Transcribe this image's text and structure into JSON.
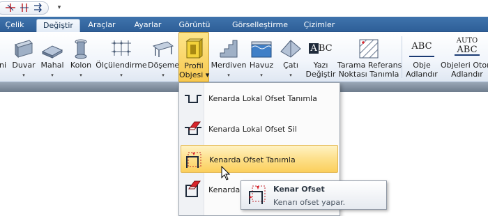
{
  "quick_access": {
    "icons": [
      "axis-icon",
      "offset-axis-icon",
      "redo-icon"
    ],
    "customize": "▾"
  },
  "tabs": [
    {
      "label": "Çelik",
      "active": false
    },
    {
      "label": "Değiştir",
      "active": true
    },
    {
      "label": "Araçlar",
      "active": false
    },
    {
      "label": "Ayarlar",
      "active": false
    },
    {
      "label": "Görüntü",
      "active": false
    },
    {
      "label": "Görselleştirme",
      "active": false
    },
    {
      "label": "Çizimler",
      "active": false
    }
  ],
  "ribbon": {
    "buttons": [
      {
        "label1": "ni",
        "label2": "",
        "icon": "wall-icon",
        "arrow": ""
      },
      {
        "label1": "Duvar",
        "label2": "",
        "icon": "wall-icon",
        "arrow": "▾"
      },
      {
        "label1": "Mahal",
        "label2": "",
        "icon": "room-slab-icon",
        "arrow": "▾"
      },
      {
        "label1": "Kolon",
        "label2": "",
        "icon": "column-icon",
        "arrow": "▾"
      },
      {
        "label1": "Ölçülendirme",
        "label2": "",
        "icon": "dimension-icon",
        "arrow": "▾"
      },
      {
        "label1": "Döşeme",
        "label2": "",
        "icon": "floor-slab-icon",
        "arrow": "▾"
      },
      {
        "label1": "Profil",
        "label2": "Objesi ▾",
        "icon": "profile-object-icon",
        "arrow": ""
      },
      {
        "label1": "Merdiven",
        "label2": "",
        "icon": "stairs-icon",
        "arrow": "▾"
      },
      {
        "label1": "Havuz",
        "label2": "",
        "icon": "pool-icon",
        "arrow": "▾"
      },
      {
        "label1": "Çatı",
        "label2": "",
        "icon": "roof-icon",
        "arrow": "▾"
      },
      {
        "label1": "Yazı",
        "label2": "Değiştir",
        "icon": "text-edit-icon",
        "arrow": ""
      },
      {
        "label1": "Tarama Referans",
        "label2": "Noktası Tanımla",
        "icon": "hatch-reference-icon",
        "arrow": ""
      },
      {
        "label1": "Obje",
        "label2": "Adlandır",
        "icon": "object-name-icon",
        "arrow": ""
      },
      {
        "label1": "Objeleri Otom",
        "label2": "Adlandır",
        "icon": "auto-name-icon",
        "arrow": ""
      }
    ],
    "text_icons": {
      "abc": "ABC",
      "auto": "AUTO",
      "abc_b": "ABC",
      "text_aa": "A",
      "text_bc": "BC"
    }
  },
  "dropdown": {
    "items": [
      {
        "label": "Kenarda Lokal Ofset Tanımla",
        "icon": "local-offset-icon",
        "hover": false
      },
      {
        "label": "Kenarda Lokal Ofset Sil",
        "icon": "local-offset-delete-icon",
        "hover": false
      },
      {
        "label": "Kenarda Ofset Tanımla",
        "icon": "edge-offset-icon",
        "hover": true
      },
      {
        "label": "Kenarda O",
        "icon": "edge-offset-delete-icon",
        "hover": false
      }
    ]
  },
  "tooltip": {
    "title": "Kenar Ofset",
    "description": "Kenarı ofset yapar."
  },
  "colors": {
    "tab_bar": "#3a6ba5",
    "highlight": "#fbd46a",
    "offset_red": "#d9232a"
  }
}
